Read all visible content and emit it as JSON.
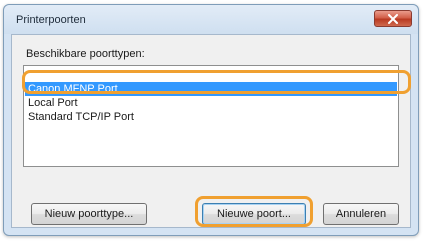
{
  "dialog": {
    "title": "Printerpoorten",
    "list_label": "Beschikbare poorttypen:",
    "port_types": [
      "Canon MFNP Port",
      "Local Port",
      "Standard TCP/IP Port"
    ],
    "selected_port": "Canon MFNP Port",
    "buttons": {
      "new_port_type": "Nieuw poorttype...",
      "new_port": "Nieuwe poort...",
      "cancel": "Annuleren"
    }
  },
  "colors": {
    "highlight_ring": "#f0a030",
    "selection": "#3399ff",
    "close_button": "#c9462c"
  },
  "icons": {
    "close": "close-x-icon"
  }
}
